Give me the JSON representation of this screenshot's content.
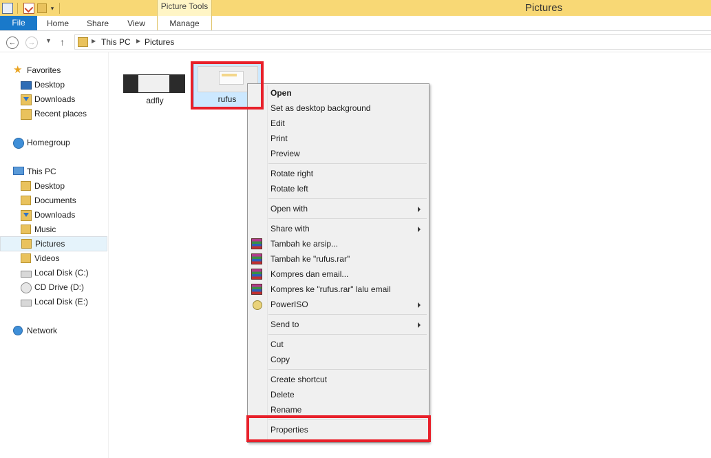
{
  "window": {
    "title": "Pictures",
    "contextual_tab": "Picture Tools"
  },
  "ribbon": {
    "tabs": [
      "File",
      "Home",
      "Share",
      "View",
      "Manage"
    ]
  },
  "address": {
    "crumbs": [
      "This PC",
      "Pictures"
    ]
  },
  "sidebar": {
    "favorites": {
      "label": "Favorites",
      "items": [
        "Desktop",
        "Downloads",
        "Recent places"
      ]
    },
    "homegroup": "Homegroup",
    "this_pc": {
      "label": "This PC",
      "items": [
        "Desktop",
        "Documents",
        "Downloads",
        "Music",
        "Pictures",
        "Videos",
        "Local Disk (C:)",
        "CD Drive (D:)",
        "Local Disk (E:)"
      ]
    },
    "network": "Network"
  },
  "files": [
    {
      "name": "adfly"
    },
    {
      "name": "rufus"
    }
  ],
  "context_menu": {
    "items": [
      "Open",
      "Set as desktop background",
      "Edit",
      "Print",
      "Preview",
      "Rotate right",
      "Rotate left",
      "Open with",
      "Share with",
      "Tambah ke arsip...",
      "Tambah ke \"rufus.rar\"",
      "Kompres dan email...",
      "Kompres ke \"rufus.rar\" lalu email",
      "PowerISO",
      "Send to",
      "Cut",
      "Copy",
      "Create shortcut",
      "Delete",
      "Rename",
      "Properties"
    ]
  },
  "colors": {
    "titlebar": "#f8d875",
    "file_tab": "#1979ca",
    "highlight": "#e8202a",
    "selection": "#cce8ff"
  }
}
